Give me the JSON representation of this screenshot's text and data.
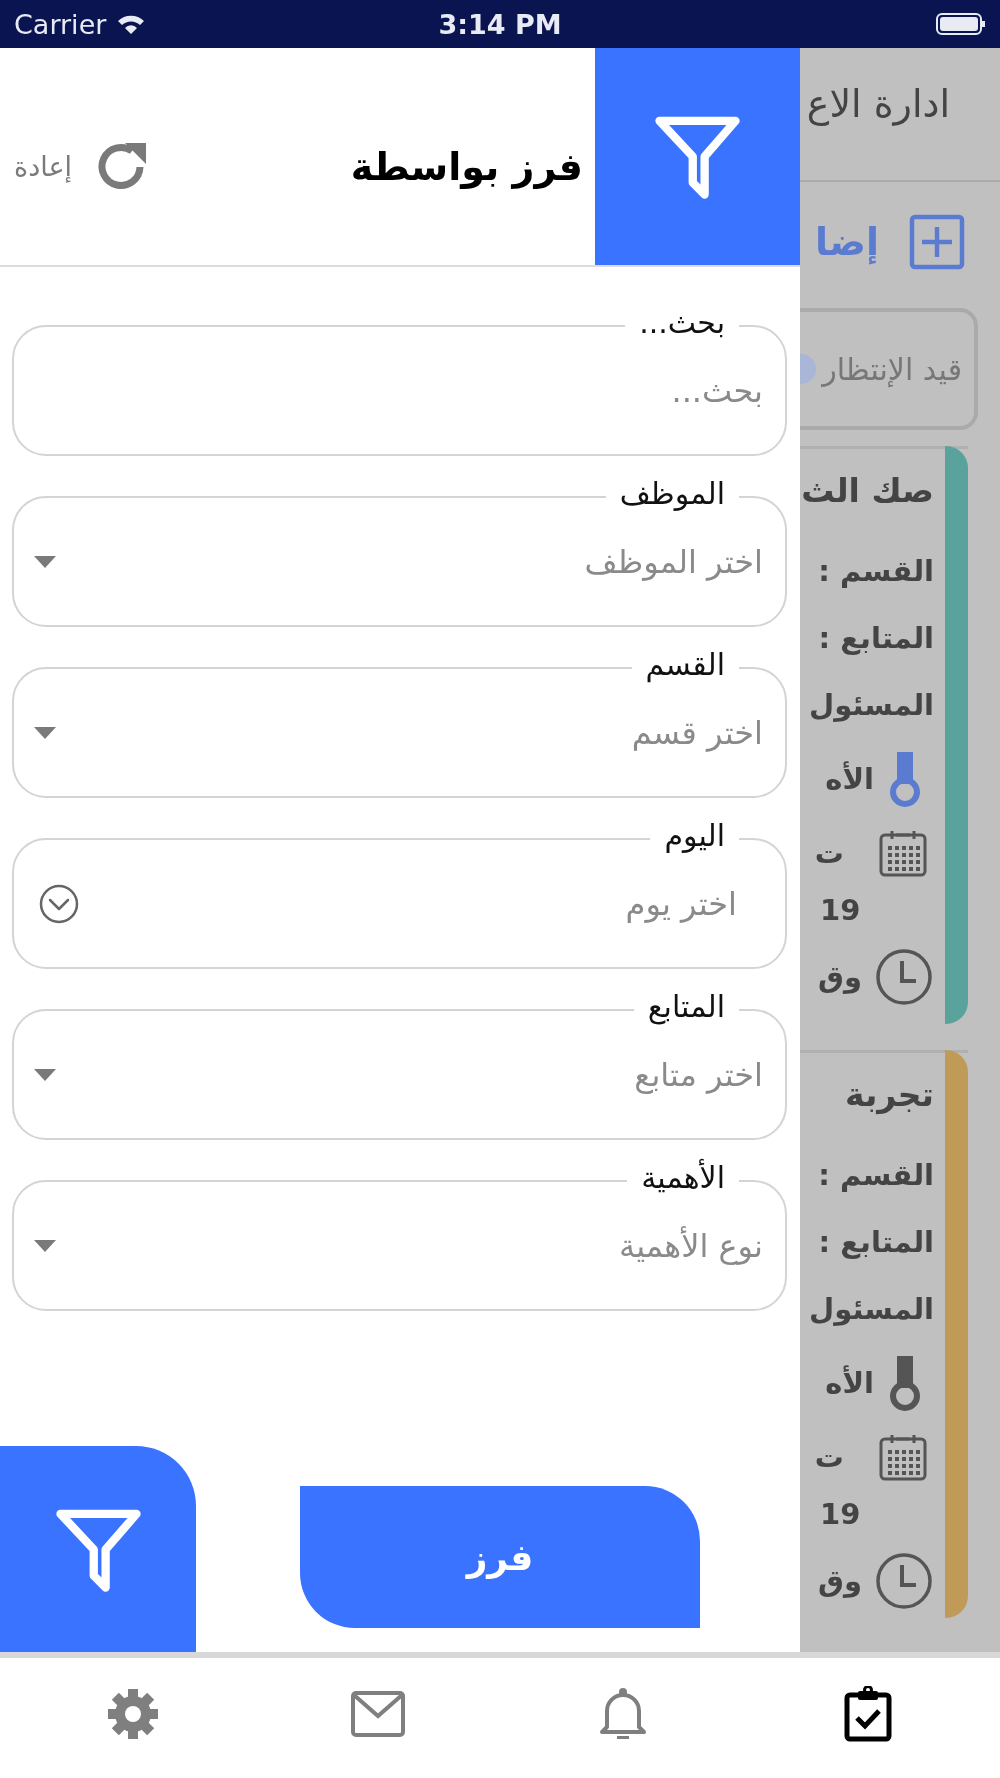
{
  "status_bar": {
    "carrier": "Carrier",
    "time": "3:14 PM"
  },
  "drawer": {
    "title": "فرز بواسطة",
    "reset_label": "إعادة",
    "fields": [
      {
        "kind": "text",
        "label": "بحث...",
        "placeholder": "بحث..."
      },
      {
        "kind": "dropdown",
        "label": "الموظف",
        "placeholder": "اختر الموظف"
      },
      {
        "kind": "dropdown",
        "label": "القسم",
        "placeholder": "اختر قسم"
      },
      {
        "kind": "date",
        "label": "اليوم",
        "placeholder": "اختر يوم"
      },
      {
        "kind": "dropdown",
        "label": "المتابع",
        "placeholder": "اختر متابع"
      },
      {
        "kind": "dropdown",
        "label": "الأهمية",
        "placeholder": "نوع الأهمية"
      }
    ],
    "apply_button": "فرز"
  },
  "background": {
    "title": "ادارة الاع",
    "add_label": "إضا",
    "status_filter": "قيد الإنتظار",
    "cards": [
      {
        "title": "صك الث",
        "color": "#5aa39c",
        "lines": [
          "القسم :",
          "المتابع :",
          "المسئول"
        ],
        "priority": "الأه",
        "priority_highlighted": true,
        "date_label": "ت",
        "date_value": "19",
        "time_label": "وق"
      },
      {
        "title": "تجربة",
        "color": "#c09b58",
        "lines": [
          "القسم :",
          "المتابع :",
          "المسئول"
        ],
        "priority": "الأه",
        "priority_highlighted": false,
        "date_label": "ت",
        "date_value": "19",
        "time_label": "وق"
      }
    ]
  },
  "tab_bar": [
    {
      "kind": "settings",
      "selected": false
    },
    {
      "kind": "mail",
      "selected": false
    },
    {
      "kind": "bell",
      "selected": false
    },
    {
      "kind": "tasks",
      "selected": true
    }
  ]
}
